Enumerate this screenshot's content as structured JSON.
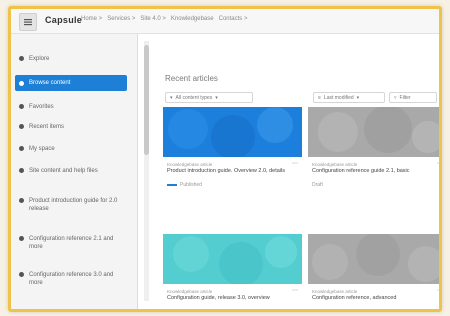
{
  "app": {
    "title": "Capsule"
  },
  "breadcrumbs": [
    "Home >",
    "Services >",
    "Site 4.0 >",
    "Knowledgebase",
    "Contacts >"
  ],
  "sidebar": {
    "items": [
      {
        "label": "Explore"
      },
      {
        "label": "Browse content",
        "active": true
      },
      {
        "label": "Favorites"
      },
      {
        "label": "Recent items"
      },
      {
        "label": "My space"
      },
      {
        "label": "Site content and help files"
      },
      {
        "label": "Product introduction guide for 2.0 release"
      },
      {
        "label": "Configuration reference 2.1 and more"
      },
      {
        "label": "Configuration reference 3.0 and more"
      }
    ]
  },
  "main": {
    "section_title": "Recent articles",
    "filters": {
      "left": "All content types",
      "middle": "Last modified",
      "right": "Filter"
    },
    "cards": [
      {
        "meta": "Knowledgebase article",
        "title": "Product introduction guide. Overview 2.0, details",
        "foot": "Published",
        "color": "#1c7fdc"
      },
      {
        "meta": "Knowledgebase article",
        "title": "Configuration reference guide 2.1, basic",
        "foot": "Draft",
        "color": "#a9a9a9"
      },
      {
        "meta": "Knowledgebase article",
        "title": "Configuration guide, release 3.0, overview",
        "foot": "",
        "color": "#54cdd0"
      },
      {
        "meta": "Knowledgebase article",
        "title": "Configuration reference, advanced",
        "foot": "",
        "color": "#a9a9a9"
      }
    ]
  }
}
